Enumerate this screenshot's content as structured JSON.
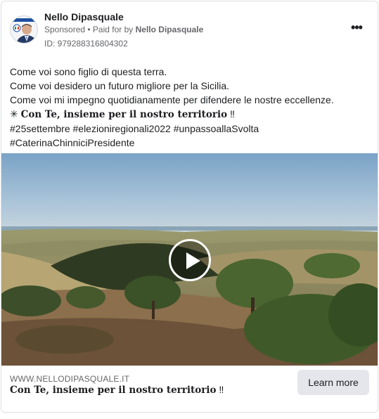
{
  "post": {
    "page_name": "Nello Dipasquale",
    "sponsored_label": "Sponsored",
    "separator": " • ",
    "paid_for_prefix": "Paid for by ",
    "paid_for_name": "Nello Dipasquale",
    "ad_id": "ID: 979288316804302",
    "more_icon": "more-horizontal-icon",
    "more_glyph": "•••"
  },
  "body": {
    "lines": [
      "Come voi sono figlio di questa terra.",
      "Come voi desidero un futuro migliore per la Sicilia.",
      "Come voi mi impegno quotidianamente per difendere le nostre eccellenze."
    ],
    "slogan_prefix": "✳ ",
    "slogan": "Con Te, insieme per il nostro territorio",
    "slogan_suffix": " ‼",
    "hashtags_line1": "#25settembre #elezioniregionali2022 #unpassoallaSvolta",
    "hashtags_line2": "#CaterinaChinniciPresidente"
  },
  "media": {
    "type": "video",
    "play_icon": "play-icon"
  },
  "link": {
    "domain": "WWW.NELLODIPASQUALE.IT",
    "headline": "Con Te, insieme per il nostro territorio",
    "headline_suffix": " ‼",
    "button_label": "Learn more"
  },
  "colors": {
    "text_primary": "#1c1e21",
    "text_secondary": "#65676b",
    "button_bg": "#e4e6eb",
    "border": "#dddfe2"
  }
}
